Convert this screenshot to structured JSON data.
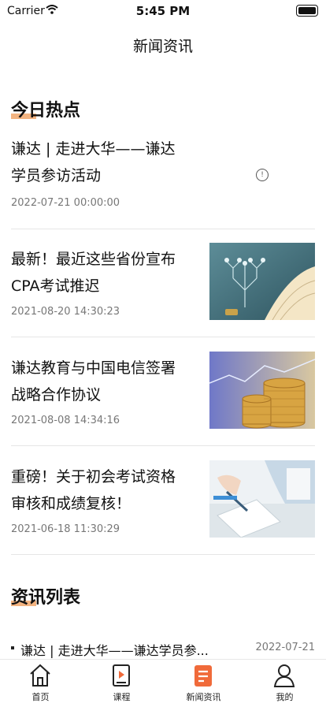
{
  "status": {
    "carrier": "Carrier",
    "time": "5:45 PM"
  },
  "nav": {
    "title": "新闻资讯"
  },
  "hot": {
    "title": "今日热点",
    "items": [
      {
        "title_line1": "谦达 | 走进大华——谦达",
        "title_line2": "学员参访活动",
        "date": "2022-07-21 00:00:00",
        "thumb": "none"
      },
      {
        "title_line1": "最新！最近这些省份宣布",
        "title_line2": "CPA考试推迟",
        "date": "2021-08-20 14:30:23",
        "thumb": "book-tree"
      },
      {
        "title_line1": "谦达教育与中国电信签署",
        "title_line2": "战略合作协议",
        "date": "2021-08-08 14:34:16",
        "thumb": "coins"
      },
      {
        "title_line1": "重磅！关于初会考试资格",
        "title_line2": "审核和成绩复核！",
        "date": "2021-06-18 11:30:29",
        "thumb": "writing"
      }
    ]
  },
  "list": {
    "title": "资讯列表",
    "rows": [
      {
        "title": "谦达 | 走进大华——谦达学员参...",
        "date": "2022-07-21"
      }
    ]
  },
  "tabs": [
    {
      "label": "首页",
      "icon": "home-icon"
    },
    {
      "label": "课程",
      "icon": "play-book-icon"
    },
    {
      "label": "新闻资讯",
      "icon": "news-icon"
    },
    {
      "label": "我的",
      "icon": "person-icon"
    }
  ],
  "colors": {
    "accent": "#f06a3a",
    "underline": "#f0a060"
  }
}
